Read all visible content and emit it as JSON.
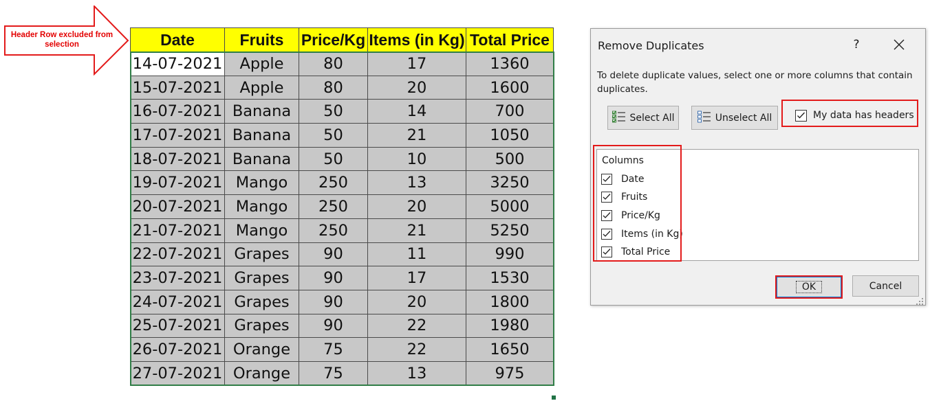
{
  "callout": {
    "text": "Header Row excluded from selection"
  },
  "sheet": {
    "headers": [
      "Date",
      "Fruits",
      "Price/Kg",
      "Items (in Kg)",
      "Total Price"
    ],
    "rows": [
      [
        "14-07-2021",
        "Apple",
        "80",
        "17",
        "1360"
      ],
      [
        "15-07-2021",
        "Apple",
        "80",
        "20",
        "1600"
      ],
      [
        "16-07-2021",
        "Banana",
        "50",
        "14",
        "700"
      ],
      [
        "17-07-2021",
        "Banana",
        "50",
        "21",
        "1050"
      ],
      [
        "18-07-2021",
        "Banana",
        "50",
        "10",
        "500"
      ],
      [
        "19-07-2021",
        "Mango",
        "250",
        "13",
        "3250"
      ],
      [
        "20-07-2021",
        "Mango",
        "250",
        "20",
        "5000"
      ],
      [
        "21-07-2021",
        "Mango",
        "250",
        "21",
        "5250"
      ],
      [
        "22-07-2021",
        "Grapes",
        "90",
        "11",
        "990"
      ],
      [
        "23-07-2021",
        "Grapes",
        "90",
        "17",
        "1530"
      ],
      [
        "24-07-2021",
        "Grapes",
        "90",
        "20",
        "1800"
      ],
      [
        "25-07-2021",
        "Grapes",
        "90",
        "22",
        "1980"
      ],
      [
        "26-07-2021",
        "Orange",
        "75",
        "22",
        "1650"
      ],
      [
        "27-07-2021",
        "Orange",
        "75",
        "13",
        "975"
      ]
    ]
  },
  "dialog": {
    "title": "Remove Duplicates",
    "help": "?",
    "description": "To delete duplicate values, select one or more columns that contain duplicates.",
    "select_all": "Select All",
    "unselect_all": "Unselect All",
    "my_data_has_headers": "My data has headers",
    "my_data_has_headers_checked": true,
    "columns_title": "Columns",
    "columns": [
      {
        "label": "Date",
        "checked": true
      },
      {
        "label": "Fruits",
        "checked": true
      },
      {
        "label": "Price/Kg",
        "checked": true
      },
      {
        "label": "Items (in Kg)",
        "checked": true
      },
      {
        "label": "Total Price",
        "checked": true
      }
    ],
    "ok": "OK",
    "cancel": "Cancel"
  },
  "colors": {
    "header_fill": "#ffff00",
    "selection_fill": "#c8c8c8",
    "annotation_red": "#e31a1a",
    "selection_border": "#2f7d46"
  }
}
